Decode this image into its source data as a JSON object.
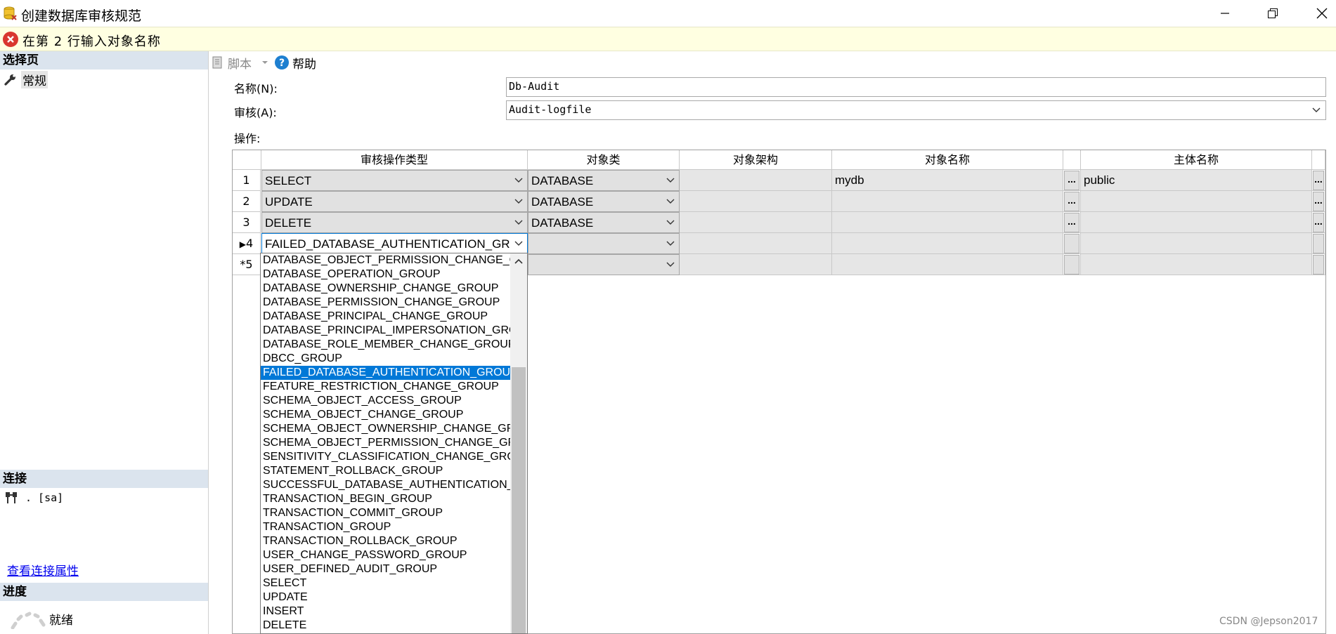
{
  "window": {
    "title": "创建数据库审核规范",
    "controls": [
      "minimize",
      "restore",
      "close"
    ]
  },
  "error": {
    "message": "在第 2 行输入对象名称"
  },
  "left": {
    "select_page": "选择页",
    "pages": [
      {
        "label": "常规",
        "icon": "wrench-icon"
      }
    ],
    "connection_header": "连接",
    "connection_value": ". [sa]",
    "view_connection_link": "查看连接属性",
    "progress_header": "进度",
    "progress_status": "就绪"
  },
  "toolbar": {
    "script_label": "脚本",
    "help_label": "帮助"
  },
  "form": {
    "name_label": "名称(N):",
    "name_value": "Db-Audit",
    "audit_label": "审核(A):",
    "audit_value": "Audit-logfile",
    "actions_label": "操作:"
  },
  "grid": {
    "columns": [
      "审核操作类型",
      "对象类",
      "对象架构",
      "对象名称",
      "主体名称"
    ],
    "rows": [
      {
        "num": "1",
        "action": "SELECT",
        "object_class": "DATABASE",
        "schema": "",
        "object_name": "mydb",
        "principal": "public"
      },
      {
        "num": "2",
        "action": "UPDATE",
        "object_class": "DATABASE",
        "schema": "",
        "object_name": "",
        "principal": ""
      },
      {
        "num": "3",
        "action": "DELETE",
        "object_class": "DATABASE",
        "schema": "",
        "object_name": "",
        "principal": ""
      },
      {
        "num": "4",
        "action": "FAILED_DATABASE_AUTHENTICATION_GR",
        "object_class": "",
        "schema": "",
        "object_name": "",
        "principal": ""
      },
      {
        "num": "5",
        "action": "",
        "object_class": "",
        "schema": "",
        "object_name": "",
        "principal": ""
      }
    ],
    "current_row_marker": "▶",
    "new_row_marker": "*",
    "ellipsis": "..."
  },
  "dropdown": {
    "items": [
      "DATABASE_OBJECT_PERMISSION_CHANGE_GROUP",
      "DATABASE_OPERATION_GROUP",
      "DATABASE_OWNERSHIP_CHANGE_GROUP",
      "DATABASE_PERMISSION_CHANGE_GROUP",
      "DATABASE_PRINCIPAL_CHANGE_GROUP",
      "DATABASE_PRINCIPAL_IMPERSONATION_GROUP",
      "DATABASE_ROLE_MEMBER_CHANGE_GROUP",
      "DBCC_GROUP",
      "FAILED_DATABASE_AUTHENTICATION_GROUP",
      "FEATURE_RESTRICTION_CHANGE_GROUP",
      "SCHEMA_OBJECT_ACCESS_GROUP",
      "SCHEMA_OBJECT_CHANGE_GROUP",
      "SCHEMA_OBJECT_OWNERSHIP_CHANGE_GROUP",
      "SCHEMA_OBJECT_PERMISSION_CHANGE_GROUP",
      "SENSITIVITY_CLASSIFICATION_CHANGE_GROUP",
      "STATEMENT_ROLLBACK_GROUP",
      "SUCCESSFUL_DATABASE_AUTHENTICATION_GROUP",
      "TRANSACTION_BEGIN_GROUP",
      "TRANSACTION_COMMIT_GROUP",
      "TRANSACTION_GROUP",
      "TRANSACTION_ROLLBACK_GROUP",
      "USER_CHANGE_PASSWORD_GROUP",
      "USER_DEFINED_AUDIT_GROUP",
      "SELECT",
      "UPDATE",
      "INSERT",
      "DELETE"
    ],
    "selected": "FAILED_DATABASE_AUTHENTICATION_GROUP"
  },
  "watermark": "CSDN @Jepson2017",
  "colors": {
    "selection": "#0078d7",
    "error_bar": "#ffffe1",
    "section_header": "#dbe4ee"
  }
}
